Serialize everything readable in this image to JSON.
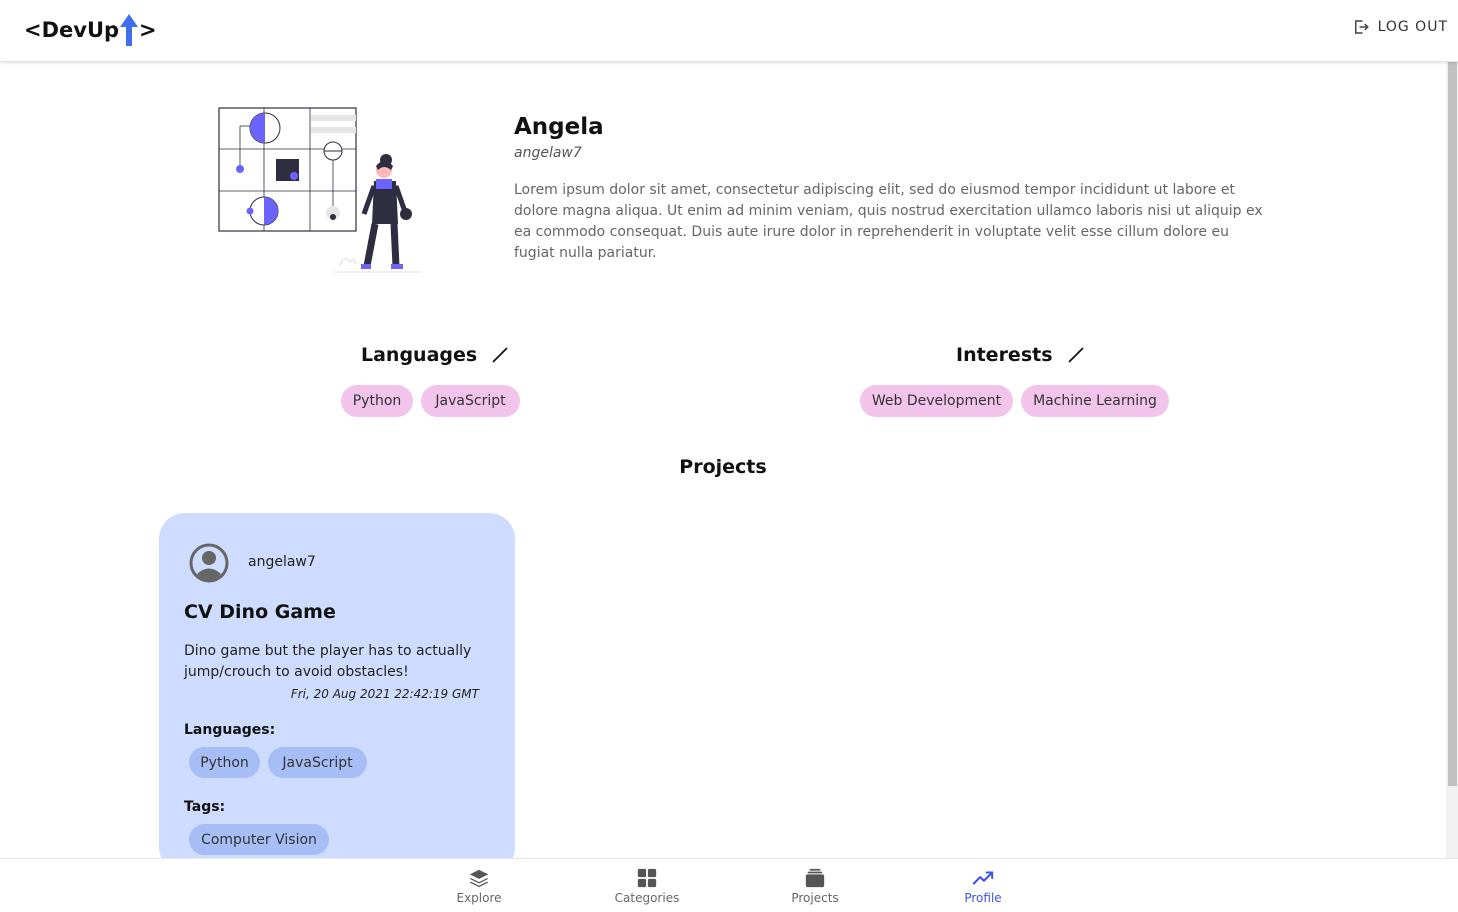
{
  "header": {
    "logo_left": "<DevUp",
    "logo_right": ">",
    "logout_label": "LOG OUT"
  },
  "profile": {
    "name": "Angela",
    "username": "angelaw7",
    "bio": "Lorem ipsum dolor sit amet, consectetur adipiscing elit, sed do eiusmod tempor incididunt ut labore et dolore magna aliqua. Ut enim ad minim veniam, quis nostrud exercitation ullamco laboris nisi ut aliquip ex ea commodo consequat. Duis aute irure dolor in reprehenderit in voluptate velit esse cillum dolore eu fugiat nulla pariatur."
  },
  "languages": {
    "title": "Languages",
    "items": [
      "Python",
      "JavaScript"
    ]
  },
  "interests": {
    "title": "Interests",
    "items": [
      "Web Development",
      "Machine Learning"
    ]
  },
  "projects": {
    "title": "Projects",
    "cards": [
      {
        "user": "angelaw7",
        "title": "CV Dino Game",
        "description": "Dino game but the player has to actually jump/crouch to avoid obstacles!",
        "date": "Fri, 20 Aug 2021 22:42:19 GMT",
        "languages_label": "Languages:",
        "languages": [
          "Python",
          "JavaScript"
        ],
        "tags_label": "Tags:",
        "tags": [
          "Computer Vision"
        ]
      }
    ]
  },
  "nav": {
    "items": [
      {
        "label": "Explore",
        "icon": "layers-icon"
      },
      {
        "label": "Categories",
        "icon": "grid-icon"
      },
      {
        "label": "Projects",
        "icon": "stack-icon"
      },
      {
        "label": "Profile",
        "icon": "trending-icon"
      }
    ],
    "active": "Profile"
  },
  "colors": {
    "accent": "#3f51e8",
    "chip_pink": "#f2c4ec",
    "card_bg": "#cedcff",
    "card_chip": "#a6bdf6",
    "illustration_purple": "#6c63ff"
  }
}
